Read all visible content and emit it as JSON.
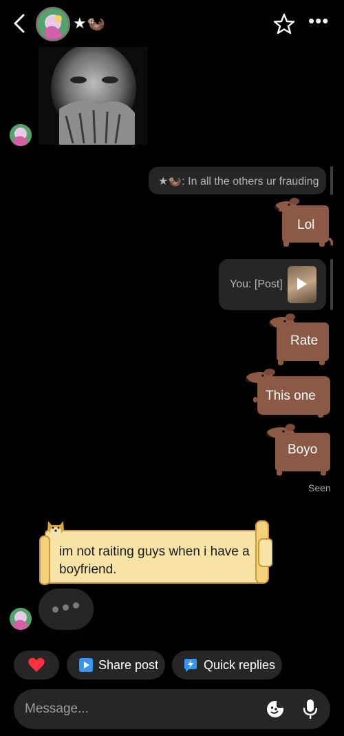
{
  "header": {
    "name": "★🦦",
    "more_label": "•••"
  },
  "messages": {
    "reply_preview": "★🦦: In all the others ur frauding",
    "stickers": [
      "Lol",
      "Rate",
      "This one",
      "Boyo"
    ],
    "post_preview": "You: [Post]",
    "seen": "Seen",
    "incoming_text": "im not raiting guys when i have a boyfriend."
  },
  "quick_actions": {
    "share_post": "Share post",
    "quick_replies": "Quick replies"
  },
  "composer": {
    "placeholder": "Message..."
  },
  "colors": {
    "background": "#000000",
    "bubble": "#262626",
    "sticker_brown": "#8c5a44",
    "scroll_yellow": "#f6e3a5",
    "heart": "#ff3040",
    "share_icon": "#3797f0"
  }
}
